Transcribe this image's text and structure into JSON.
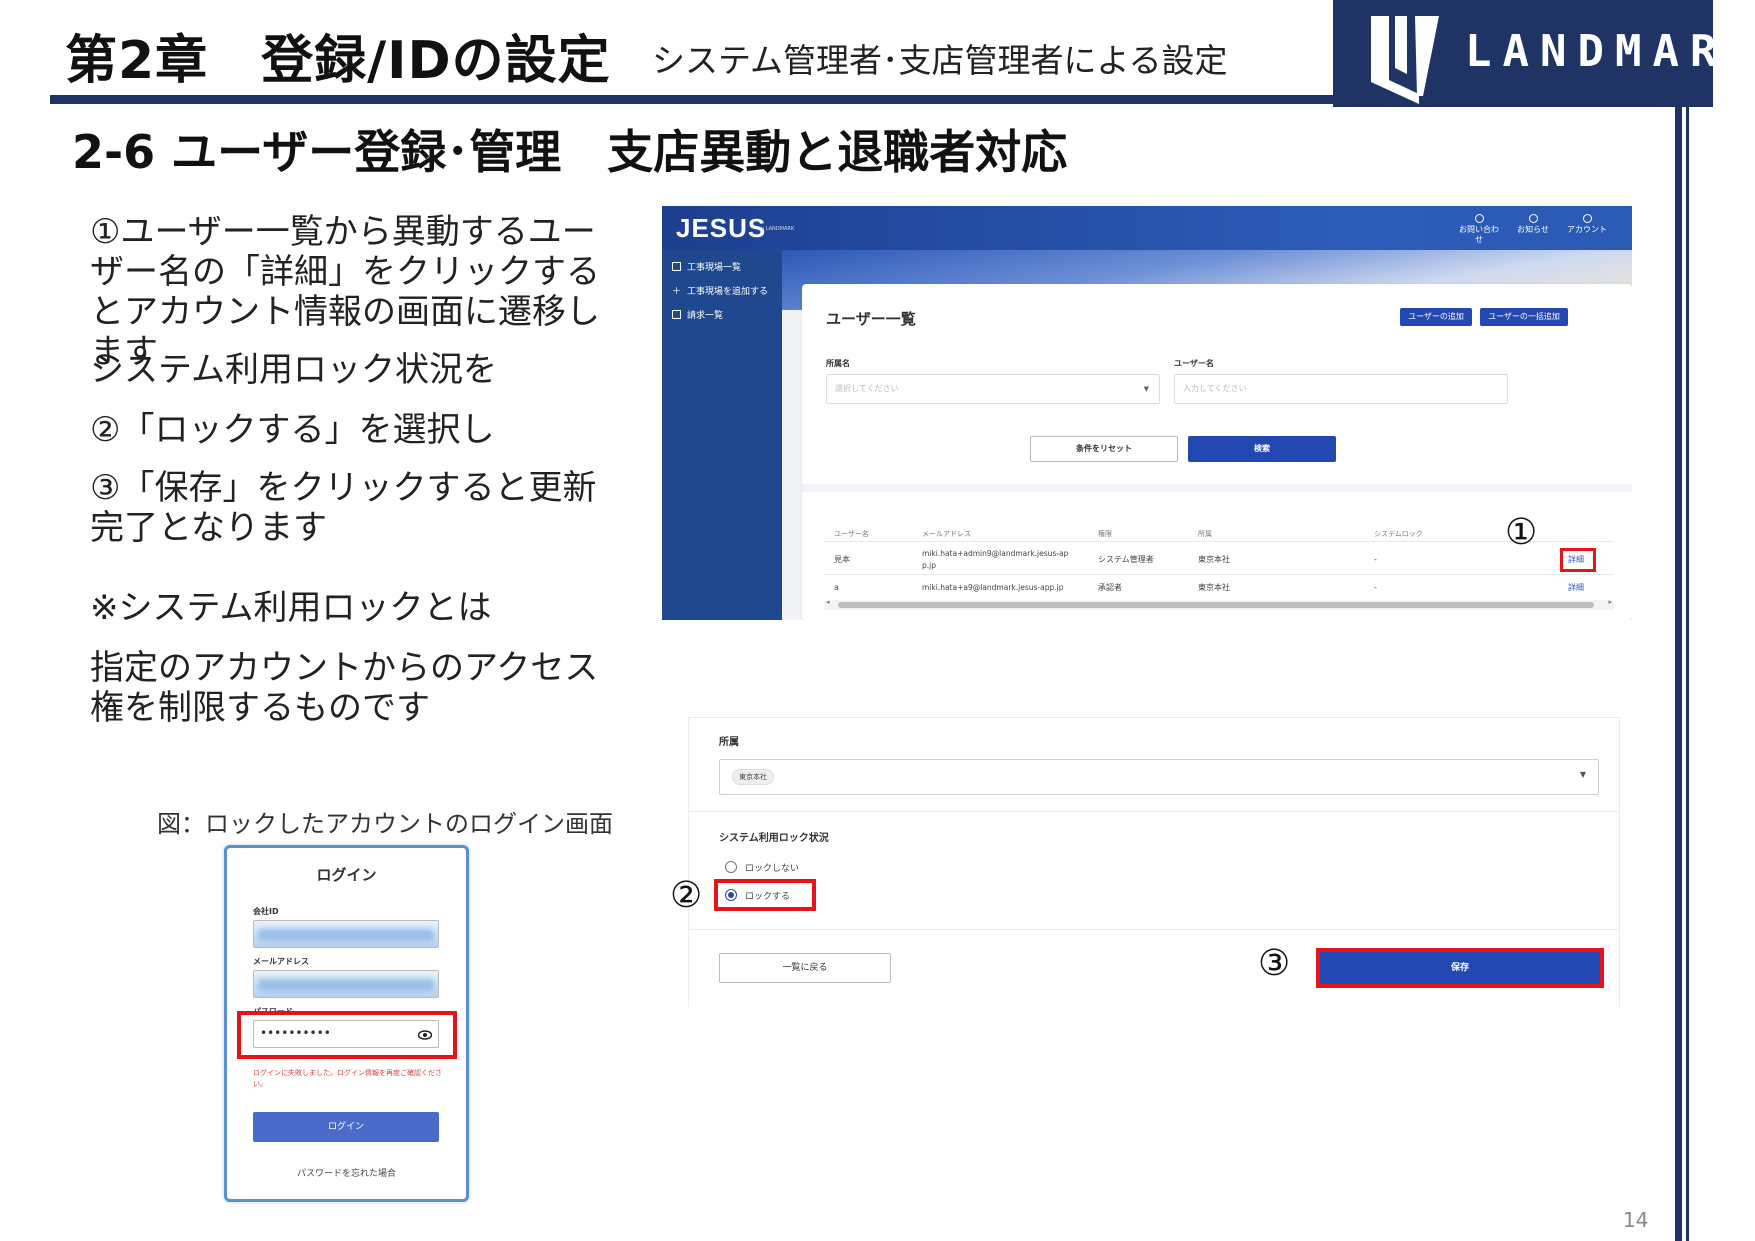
{
  "header": {
    "chapter_title": "第2章　登録/IDの設定",
    "chapter_subtitle": "システム管理者･支店管理者による設定",
    "brand": "LANDMARK",
    "brand_color": "#1f3464"
  },
  "section_title": "2-6 ユーザー登録･管理　支店異動と退職者対応",
  "instructions": {
    "step1": "①ユーザー一覧から異動するユーザー名の「詳細」をクリックするとアカウント情報の画面に遷移します",
    "intro2": "システム利用ロック状況を",
    "step2": "②「ロックする」を選択し",
    "step3": "③「保存」をクリックすると更新完了となります",
    "note_title": "※システム利用ロックとは",
    "note_body": "指定のアカウントからのアクセス権を制限するものです"
  },
  "figure_caption": "図：ロックしたアカウントのログイン画面",
  "login_screen": {
    "title": "ログイン",
    "company_id_label": "会社ID",
    "email_label": "メールアドレス",
    "password_label": "パスワード",
    "password_value": "••••••••••",
    "error_message": "ログインに失敗しました。ログイン情報を再度ご確認ください。",
    "login_button": "ログイン",
    "forgot_link": "パスワードを忘れた場合",
    "icons": {
      "password_toggle": "eye-icon"
    }
  },
  "user_list_screen": {
    "logo": "JESUS",
    "logo_sub": "by LANDMARK",
    "top_nav": [
      "お問い合わせ",
      "お知らせ",
      "アカウント"
    ],
    "sidebar": [
      {
        "label": "工事現場一覧",
        "icon": "list-icon"
      },
      {
        "label": "工事現場を追加する",
        "icon": "plus-icon"
      },
      {
        "label": "請求一覧",
        "icon": "document-icon"
      }
    ],
    "title": "ユーザー一覧",
    "buttons": {
      "add_user": "ユーザーの追加",
      "bulk_add": "ユーザーの一括追加",
      "reset": "条件をリセット",
      "search": "検索"
    },
    "filters": {
      "affiliation_label": "所属名",
      "affiliation_placeholder": "選択してください",
      "username_label": "ユーザー名",
      "username_placeholder": "入力してください"
    },
    "table": {
      "columns": [
        "ユーザー名",
        "メールアドレス",
        "権限",
        "所属",
        "システムロック"
      ],
      "rows": [
        {
          "name": "見本",
          "email": "miki.hata+admin9@landmark.jesus-app.jp",
          "role": "システム管理者",
          "affiliation": "東京本社",
          "lock": "-",
          "action": "詳細"
        },
        {
          "name": "a",
          "email": "miki.hata+a9@landmark.jesus-app.jp",
          "role": "承認者",
          "affiliation": "東京本社",
          "lock": "-",
          "action": "詳細"
        }
      ]
    }
  },
  "account_screen": {
    "affiliation_label": "所属",
    "affiliation_value": "東京本社",
    "lock_status_label": "システム利用ロック状況",
    "radio_unlocked": "ロックしない",
    "radio_locked": "ロックする",
    "selected": "ロックする",
    "back_button": "一覧に戻る",
    "save_button": "保存"
  },
  "callouts": [
    "①",
    "②",
    "③"
  ],
  "highlight_color": "#e6131b",
  "page_number": "14"
}
